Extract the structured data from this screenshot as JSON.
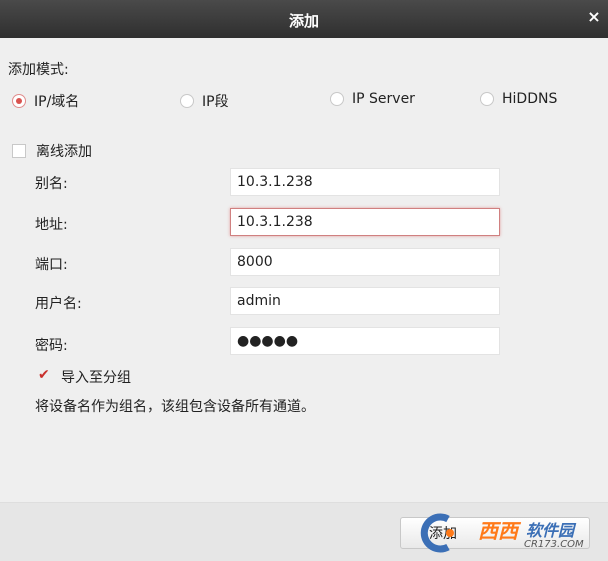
{
  "window": {
    "title": "添加",
    "close_glyph": "×"
  },
  "mode": {
    "label": "添加模式:",
    "options": [
      "IP/域名",
      "IP段",
      "IP Server",
      "HiDDNS"
    ],
    "selected": "IP/域名"
  },
  "offline_add": {
    "label": "离线添加",
    "checked": false
  },
  "form": {
    "alias_label": "别名:",
    "alias_value": "10.3.1.238",
    "address_label": "地址:",
    "address_value": "10.3.1.238",
    "port_label": "端口:",
    "port_value": "8000",
    "username_label": "用户名:",
    "username_value": "admin",
    "password_label": "密码:",
    "password_value": "●●●●●"
  },
  "import_group": {
    "label": "导入至分组",
    "checked": true
  },
  "note": "将设备名作为组名，该组包含设备所有通道。",
  "footer": {
    "add_label": "添加"
  },
  "watermark": {
    "brand_cn": "西西",
    "brand_suffix": "软件园",
    "url": "CR173.COM"
  },
  "colors": {
    "accent": "#d9534f",
    "titlebar": "#3a3a3a",
    "background": "#efefef"
  }
}
